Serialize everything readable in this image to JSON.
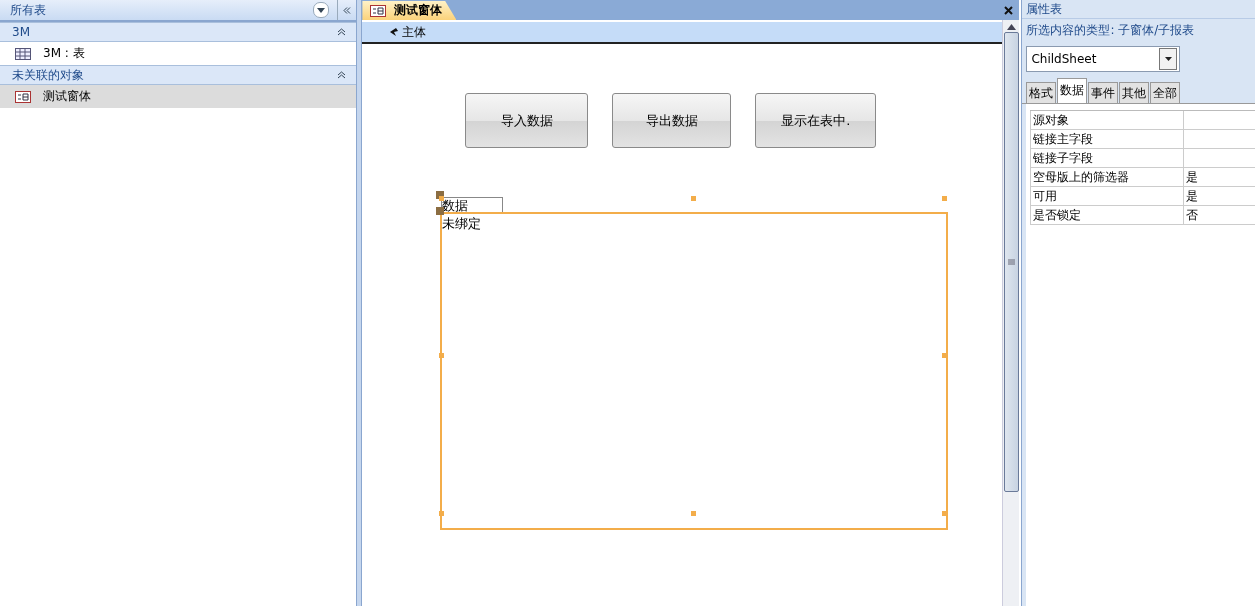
{
  "nav": {
    "title": "所有表",
    "groups": [
      {
        "name": "3M",
        "expanded": true,
        "items": [
          {
            "label": "3M : 表",
            "kind": "table",
            "selected": false
          }
        ]
      },
      {
        "name": "未关联的对象",
        "expanded": true,
        "items": [
          {
            "label": "测试窗体",
            "kind": "form",
            "selected": true
          }
        ]
      }
    ]
  },
  "document": {
    "tab": "测试窗体",
    "section": "主体",
    "buttons": [
      "导入数据",
      "导出数据",
      "显示在表中."
    ],
    "subform": {
      "label": "数据",
      "content": "未绑定"
    }
  },
  "properties": {
    "title": "属性表",
    "selection_type": "所选内容的类型: 子窗体/子报表",
    "object": "ChildSheet",
    "tabs": [
      {
        "label": "格式",
        "selected": false
      },
      {
        "label": "数据",
        "selected": true
      },
      {
        "label": "事件",
        "selected": false
      },
      {
        "label": "其他",
        "selected": false
      },
      {
        "label": "全部",
        "selected": false
      }
    ],
    "rows": [
      {
        "name": "源对象",
        "value": ""
      },
      {
        "name": "链接主字段",
        "value": ""
      },
      {
        "name": "链接子字段",
        "value": ""
      },
      {
        "name": "空母版上的筛选器",
        "value": "是"
      },
      {
        "name": "可用",
        "value": "是"
      },
      {
        "name": "是否锁定",
        "value": "否"
      }
    ]
  }
}
